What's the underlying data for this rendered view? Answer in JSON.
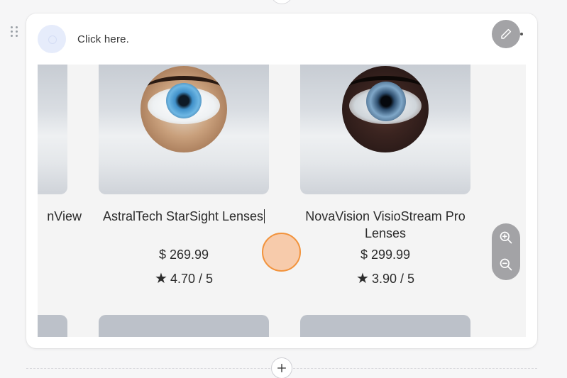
{
  "header": {
    "prompt_text": "Click here.",
    "more_icon": "more-horizontal-icon"
  },
  "products": [
    {
      "name": "nView",
      "price": "",
      "rating": ""
    },
    {
      "name": "AstralTech StarSight Lenses",
      "price": "$ 269.99",
      "rating": "4.70 / 5",
      "eye": "blue"
    },
    {
      "name": "NovaVision VisioStream Pro Lenses",
      "price": "$ 299.99",
      "rating": "3.90 / 5",
      "eye": "dark"
    }
  ],
  "controls": {
    "edit_icon": "pencil-icon",
    "zoom_in_icon": "zoom-in-icon",
    "zoom_out_icon": "zoom-out-icon",
    "add_icon": "plus-icon"
  },
  "colors": {
    "cursor_fill": "#f8b98c",
    "cursor_border": "#f2933c",
    "control_bg": "#a3a3a6"
  }
}
